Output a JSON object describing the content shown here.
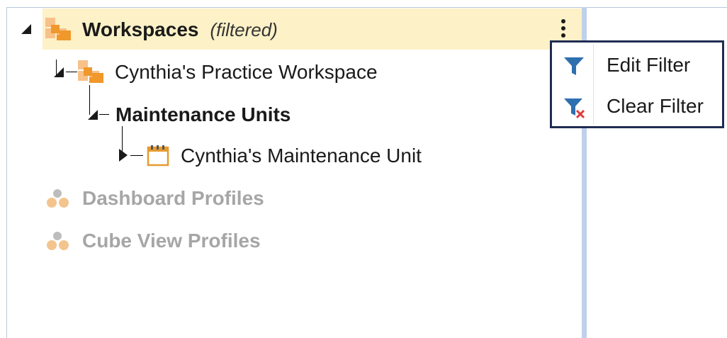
{
  "tree": {
    "root": {
      "label": "Workspaces",
      "qualifier": "(filtered)",
      "icon": "workspace-folder-icon",
      "selected": true
    },
    "workspace": {
      "label": "Cynthia's Practice Workspace",
      "icon": "workspace-folder-icon"
    },
    "group": {
      "label": "Maintenance Units"
    },
    "unit": {
      "label": "Cynthia's Maintenance Unit",
      "icon": "maintenance-unit-icon"
    },
    "dashboard_profiles": {
      "label": "Dashboard Profiles",
      "icon": "profile-cluster-icon"
    },
    "cube_view_profiles": {
      "label": "Cube View Profiles",
      "icon": "profile-cluster-icon"
    }
  },
  "context_menu": {
    "items": [
      {
        "label": "Edit Filter",
        "icon": "filter-icon"
      },
      {
        "label": "Clear Filter",
        "icon": "clear-filter-icon"
      }
    ]
  },
  "colors": {
    "selection_bg": "#fdf1c7",
    "menu_border": "#1f2d52",
    "accent_blue": "#2e6fb0",
    "folder_orange": "#f0982b",
    "disabled_text": "#a6a6a6"
  }
}
